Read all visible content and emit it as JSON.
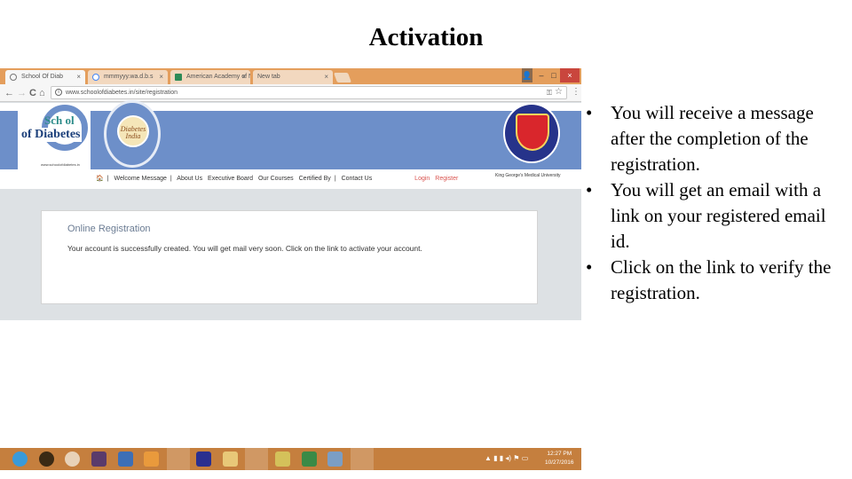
{
  "slide": {
    "title": "Activation",
    "bullets": [
      "You will receive a message after the completion of the registration.",
      "You will get an email with a link on your registered email id.",
      "Click on the link to verify the registration."
    ]
  },
  "browser": {
    "tabs": [
      {
        "label": "School Of Diab",
        "icon": "loading-icon",
        "active": true
      },
      {
        "label": "mmmyyy.wa.d.b.s",
        "icon": "google-icon",
        "active": false
      },
      {
        "label": "American Academy of N",
        "icon": "bookmark-icon",
        "active": false
      },
      {
        "label": "New tab",
        "icon": "none",
        "active": false
      }
    ],
    "tab_close": "×",
    "nav": {
      "back": "←",
      "forward": "→",
      "reload": "C",
      "home": "⌂"
    },
    "url": "www.schoolofdiabetes.in/site/registration",
    "window_controls": {
      "user": "👤",
      "minimize": "–",
      "maximize": "□",
      "close": "×"
    },
    "menu": "⋮",
    "star": "☆"
  },
  "website": {
    "logo_school": "Sch  ol",
    "logo_diabetes": "of Diabetes",
    "logo_url": "www.schoolofdiabetes.in",
    "seal_text": "Diabetes India",
    "kgmu_caption": "King George's Medical University",
    "nav_items": [
      {
        "label": "Welcome Message",
        "sep": "|"
      },
      {
        "label": "About Us",
        "sep": ""
      },
      {
        "label": "Executive Board",
        "sep": ""
      },
      {
        "label": "Our Courses",
        "sep": ""
      },
      {
        "label": "Certified By",
        "sep": "|"
      },
      {
        "label": "Contact Us",
        "sep": ""
      }
    ],
    "nav_home_icon": "🏠",
    "login": "Login",
    "register": "Register",
    "panel_title": "Online Registration",
    "panel_message": "Your account is successfully created. You will get mail very soon. Click on the link to activate your account."
  },
  "taskbar": {
    "apps": [
      "internet-explorer-icon",
      "media-app-icon",
      "hp-icon",
      "store-app-icon",
      "word-icon",
      "media-player-icon",
      "user-app-icon",
      "adobe-icon",
      "file-explorer-icon",
      "chrome-icon",
      "folder-icon",
      "excel-icon",
      "calculator-icon",
      "powerpoint-icon"
    ],
    "tray": "▲",
    "time": "12:27 PM",
    "date": "10/27/2016"
  },
  "colors": {
    "banner": "#6d8fc9",
    "tabbar": "#e49e5c",
    "taskbar": "#c57f3e",
    "link_red": "#d9534f",
    "close_red": "#c9463d"
  }
}
